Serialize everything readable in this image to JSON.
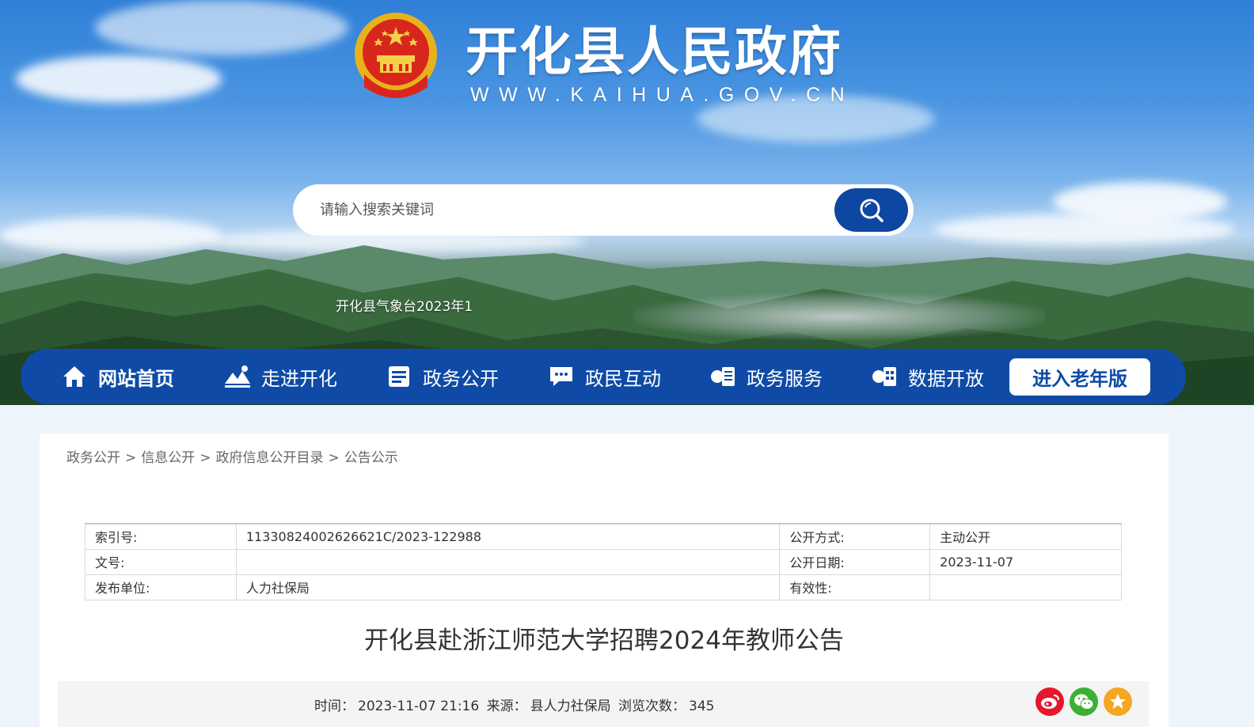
{
  "header": {
    "site_title": "开化县人民政府",
    "site_url": "WWW.KAIHUA.GOV.CN",
    "emblem_icon": "national-emblem-icon"
  },
  "search": {
    "placeholder": "请输入搜索关键词",
    "button_icon": "search-icon"
  },
  "ticker": {
    "text": "开化县气象台2023年1"
  },
  "nav": {
    "items": [
      {
        "label": "网站首页",
        "icon": "home-icon"
      },
      {
        "label": "走进开化",
        "icon": "landscape-icon"
      },
      {
        "label": "政务公开",
        "icon": "document-icon"
      },
      {
        "label": "政民互动",
        "icon": "chat-icon"
      },
      {
        "label": "政务服务",
        "icon": "service-icon"
      },
      {
        "label": "数据开放",
        "icon": "data-icon"
      }
    ],
    "elder_button": "进入老年版"
  },
  "breadcrumb": [
    "政务公开",
    "信息公开",
    "政府信息公开目录",
    "公告公示"
  ],
  "breadcrumb_separator": ">",
  "meta": {
    "rows": [
      {
        "label1": "索引号:",
        "value1": "11330824002626621C/2023-122988",
        "label2": "公开方式:",
        "value2": "主动公开"
      },
      {
        "label1": "文号:",
        "value1": "",
        "label2": "公开日期:",
        "value2": "2023-11-07"
      },
      {
        "label1": "发布单位:",
        "value1": "人力社保局",
        "label2": "有效性:",
        "value2": ""
      }
    ]
  },
  "article": {
    "title": "开化县赴浙江师范大学招聘2024年教师公告",
    "time_label": "时间：",
    "time": "2023-11-07 21:16",
    "source_label": "来源：",
    "source": "县人力社保局",
    "views_label": "浏览次数：",
    "views": "345"
  },
  "share": [
    {
      "icon": "weibo-icon",
      "color": "#e6162d"
    },
    {
      "icon": "wechat-icon",
      "color": "#3cb034"
    },
    {
      "icon": "favorite-star-icon",
      "color": "#f5a623"
    }
  ],
  "colors": {
    "nav_blue": "#0f4ba6",
    "search_button": "#0d47a1"
  }
}
